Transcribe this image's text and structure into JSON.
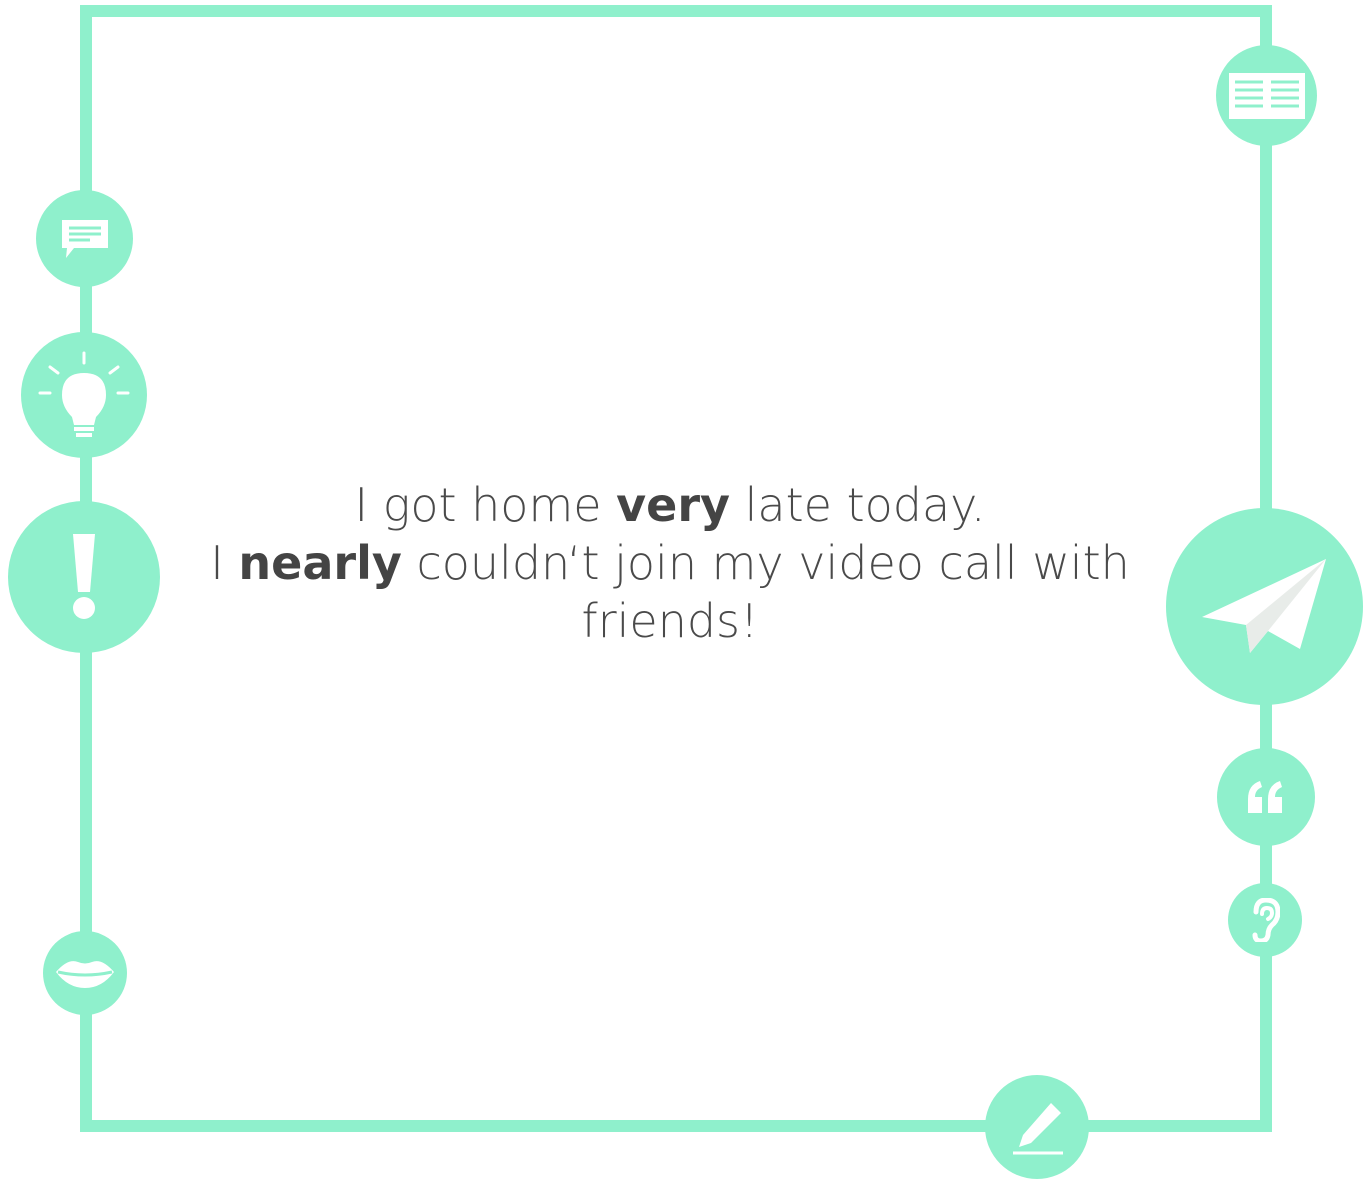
{
  "colors": {
    "accent": "#8ff0cc",
    "icon_glyph": "#ffffff",
    "text": "#4a4a4a",
    "background": "#ffffff"
  },
  "message": {
    "line1": {
      "pre": "I got home ",
      "bold": "very",
      "post": " late today."
    },
    "line2": {
      "pre": "I ",
      "bold": "nearly",
      "post": " couldn‘t join my video call with"
    },
    "line3": {
      "text": "friends!"
    }
  },
  "icons": [
    "news-icon",
    "chat-icon",
    "lightbulb-icon",
    "exclamation-icon",
    "lips-icon",
    "paper-plane-icon",
    "quote-icon",
    "ear-icon",
    "pencil-icon"
  ]
}
